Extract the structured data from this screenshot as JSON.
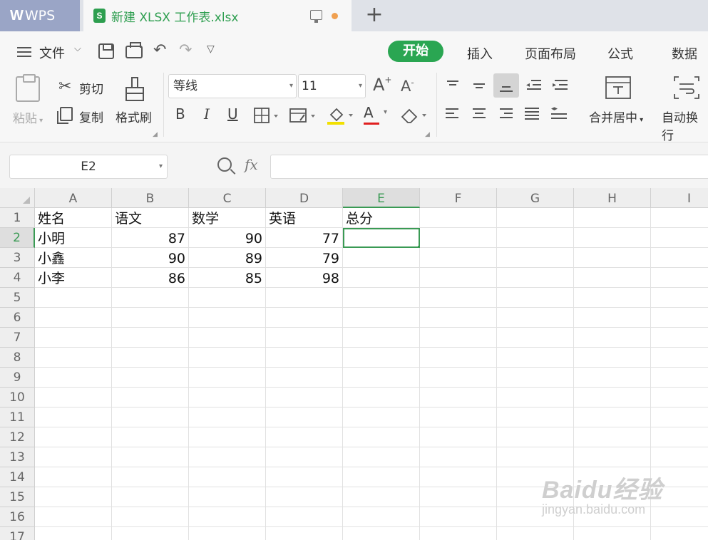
{
  "titlebar": {
    "brand": "WPS",
    "file_tab_icon": "S",
    "file_tab_title": "新建 XLSX 工作表.xlsx",
    "new_tab_icon": "+"
  },
  "menu": {
    "file_label": "文件",
    "tabs": [
      {
        "label": "开始",
        "active": true
      },
      {
        "label": "插入"
      },
      {
        "label": "页面布局"
      },
      {
        "label": "公式"
      },
      {
        "label": "数据"
      }
    ]
  },
  "ribbon": {
    "paste_label": "粘贴",
    "cut_label": "剪切",
    "copy_label": "复制",
    "format_painter_label": "格式刷",
    "font_name": "等线",
    "font_size": "11",
    "bold": "B",
    "italic": "I",
    "underline": "U",
    "font_color_glyph": "A",
    "merge_label": "合并居中",
    "wrap_label": "自动换行"
  },
  "formula_bar": {
    "name_box": "E2",
    "fx_label": "fx",
    "value": ""
  },
  "sheet": {
    "columns": [
      "A",
      "B",
      "C",
      "D",
      "E",
      "F",
      "G",
      "H",
      "I"
    ],
    "selected_column": "E",
    "rows": [
      "1",
      "2",
      "3",
      "4",
      "5",
      "6",
      "7",
      "8",
      "9",
      "10",
      "11",
      "12",
      "13",
      "14",
      "15",
      "16",
      "17"
    ],
    "selected_row": "2",
    "data": [
      [
        "姓名",
        "语文",
        "数学",
        "英语",
        "总分"
      ],
      [
        "小明",
        "87",
        "90",
        "77",
        ""
      ],
      [
        "小鑫",
        "90",
        "89",
        "79",
        ""
      ],
      [
        "小李",
        "86",
        "85",
        "98",
        ""
      ]
    ],
    "active_cell": "E2"
  },
  "watermark": {
    "brand": "Baidu经验",
    "url": "jingyan.baidu.com"
  },
  "colors": {
    "accent_green": "#2aa652",
    "selection_green": "#3a9a54",
    "wps_tab": "#9aa5c6"
  }
}
